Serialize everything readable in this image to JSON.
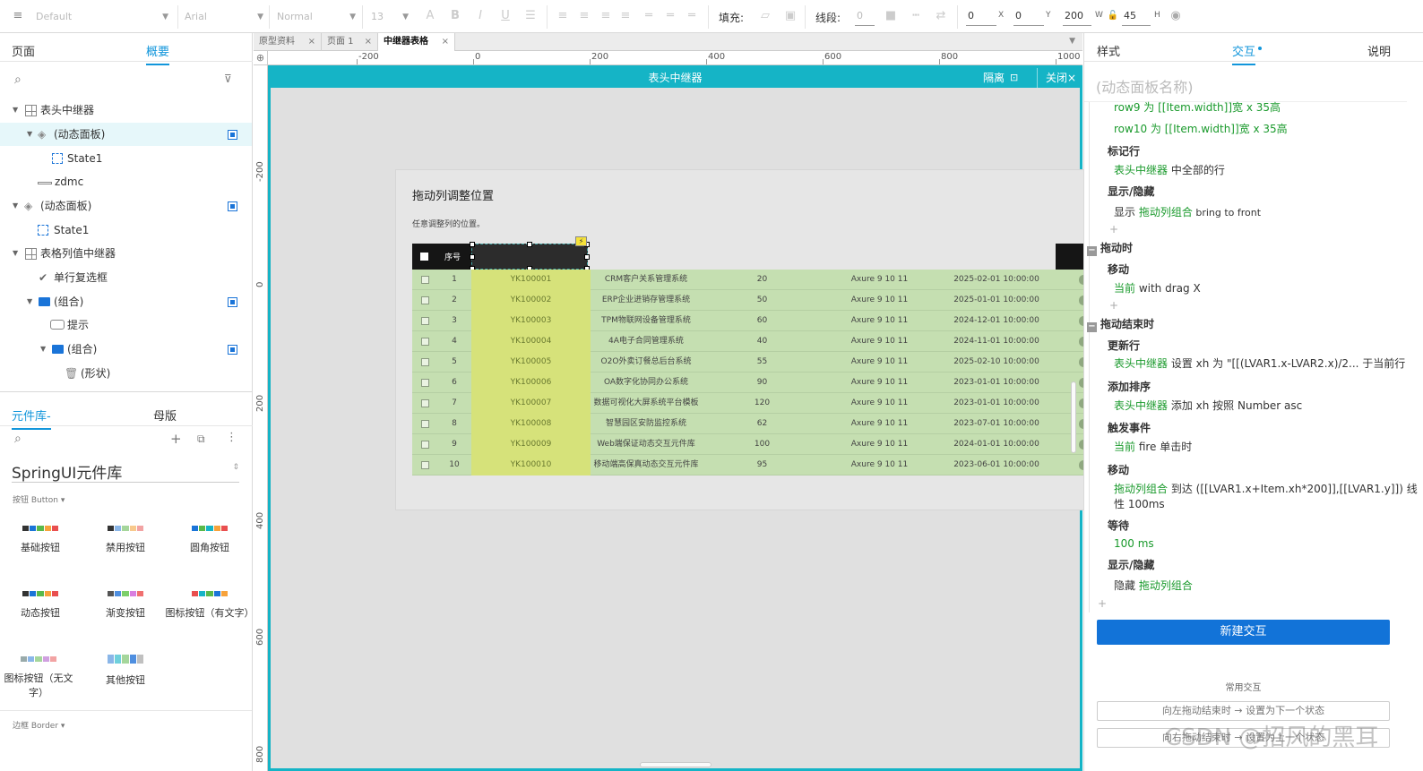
{
  "toolbar": {
    "style_select": "Default",
    "font_select": "Arial",
    "weight_select": "Normal",
    "size_select": "13",
    "fill_label": "填充:",
    "line_label": "线段:",
    "line_value": "0",
    "x_value": "0",
    "x_label": "X",
    "y_value": "0",
    "y_label": "Y",
    "w_value": "200",
    "w_label": "W",
    "h_value": "45",
    "h_label": "H"
  },
  "left": {
    "tabs": [
      "页面",
      "概要"
    ],
    "outline": [
      {
        "label": "表头中继器",
        "icon": "repeater-icon"
      },
      {
        "label": "(动态面板)",
        "icon": "layers-icon"
      },
      {
        "label": "State1",
        "icon": "state-icon"
      },
      {
        "label": "zdmc",
        "icon": "line-icon"
      },
      {
        "label": "(动态面板)",
        "icon": "layers-icon"
      },
      {
        "label": "State1",
        "icon": "state-icon"
      },
      {
        "label": "表格列值中继器",
        "icon": "repeater-icon"
      },
      {
        "label": "单行复选框",
        "icon": "check-icon"
      },
      {
        "label": "(组合)",
        "icon": "folder-icon"
      },
      {
        "label": "提示",
        "icon": "tooltip-icon"
      },
      {
        "label": "(组合)",
        "icon": "folder-icon"
      },
      {
        "label": "(形状)",
        "icon": "trash-icon"
      }
    ],
    "lib_tabs": [
      "元件库-",
      "母版"
    ],
    "library_name": "SpringUI元件库",
    "section_button": "按钮 Button ▾",
    "components": [
      {
        "label": "基础按钮"
      },
      {
        "label": "禁用按钮"
      },
      {
        "label": "圆角按钮"
      },
      {
        "label": "动态按钮"
      },
      {
        "label": "渐变按钮"
      },
      {
        "label": "图标按钮（有文字）"
      },
      {
        "label": "图标按钮（无文字）"
      },
      {
        "label": "其他按钮"
      }
    ],
    "section_border": "边框 Border ▾"
  },
  "canvas": {
    "doc_tabs": [
      "原型资料",
      "页面 1",
      "中继器表格"
    ],
    "ruler_h": [
      "-200",
      "0",
      "200",
      "400",
      "600",
      "800",
      "1000"
    ],
    "ruler_v": [
      "-200",
      "0",
      "200",
      "400",
      "600",
      "800"
    ],
    "editor_title": "表头中继器",
    "isolate_label": "隔离",
    "close_label": "关闭",
    "card_title": "拖动列调整位置",
    "card_subtitle": "任意调整列的位置。",
    "header_col": "序号",
    "rows": [
      {
        "no": "1",
        "id": "YK100001",
        "name": "CRM客户关系管理系统",
        "count": "20",
        "ver": "Axure 9 10 11",
        "date": "2025-02-01 10:00:00"
      },
      {
        "no": "2",
        "id": "YK100002",
        "name": "ERP企业进销存管理系统",
        "count": "50",
        "ver": "Axure 9 10 11",
        "date": "2025-01-01 10:00:00"
      },
      {
        "no": "3",
        "id": "YK100003",
        "name": "TPM物联网设备管理系统",
        "count": "60",
        "ver": "Axure 9 10 11",
        "date": "2024-12-01 10:00:00"
      },
      {
        "no": "4",
        "id": "YK100004",
        "name": "4A电子合同管理系统",
        "count": "40",
        "ver": "Axure 9 10 11",
        "date": "2024-11-01 10:00:00"
      },
      {
        "no": "5",
        "id": "YK100005",
        "name": "O2O外卖订餐总后台系统",
        "count": "55",
        "ver": "Axure 9 10 11",
        "date": "2025-02-10 10:00:00"
      },
      {
        "no": "6",
        "id": "YK100006",
        "name": "OA数字化协同办公系统",
        "count": "90",
        "ver": "Axure 9 10 11",
        "date": "2023-01-01 10:00:00"
      },
      {
        "no": "7",
        "id": "YK100007",
        "name": "数据可视化大屏系统平台模板",
        "count": "120",
        "ver": "Axure 9 10 11",
        "date": "2023-01-01 10:00:00"
      },
      {
        "no": "8",
        "id": "YK100008",
        "name": "智慧园区安防监控系统",
        "count": "62",
        "ver": "Axure 9 10 11",
        "date": "2023-07-01 10:00:00"
      },
      {
        "no": "9",
        "id": "YK100009",
        "name": "Web端保证动态交互元件库",
        "count": "100",
        "ver": "Axure 9 10 11",
        "date": "2024-01-01 10:00:00"
      },
      {
        "no": "10",
        "id": "YK100010",
        "name": "移动端高保真动态交互元件库",
        "count": "95",
        "ver": "Axure 9 10 11",
        "date": "2023-06-01 10:00:00"
      }
    ]
  },
  "right": {
    "tabs": [
      "样式",
      "交互",
      "说明"
    ],
    "panel_name": "(动态面板名称)",
    "lines": {
      "row9": "row9 为 [[Item.width]]宽 x 35高",
      "row10": "row10 为 [[Item.width]]宽 x 35高",
      "mark": "标记行",
      "mark_a": "表头中继器",
      "mark_b": " 中全部的行",
      "show": "显示/隐藏",
      "show_a": "显示 ",
      "show_b": "拖动列组合",
      "show_c": "  bring to front",
      "drag": "拖动时",
      "move": "移动",
      "move_a": "当前",
      "move_b": " with drag X",
      "dragend": "拖动结束时",
      "update": "更新行",
      "update_a": "表头中继器",
      "update_b": " 设置 xh 为 \"[[(LVAR1.x-LVAR2.x)/2... 于当前行",
      "sort": "添加排序",
      "sort_a": "表头中继器",
      "sort_b": " 添加 xh 按照 Number asc",
      "fire": "触发事件",
      "fire_a": "当前",
      "fire_b": " fire 单击时",
      "move2": "移动",
      "move2_a": "拖动列组合",
      "move2_b": " 到达 ([[LVAR1.x+Item.xh*200]],[[LVAR1.y]]) 线",
      "move2_c": "性 100ms",
      "wait": "等待",
      "wait_a": "100 ms",
      "show2": "显示/隐藏",
      "show2_a": "隐藏 ",
      "show2_b": "拖动列组合"
    },
    "new_btn": "新建交互",
    "common": "常用交互",
    "btn1": "向左拖动结束时 → 设置为下一个状态",
    "btn2": "向右拖动结束时 → 设置为上一个状态",
    "watermark": "CSDN @招风的黑耳"
  }
}
